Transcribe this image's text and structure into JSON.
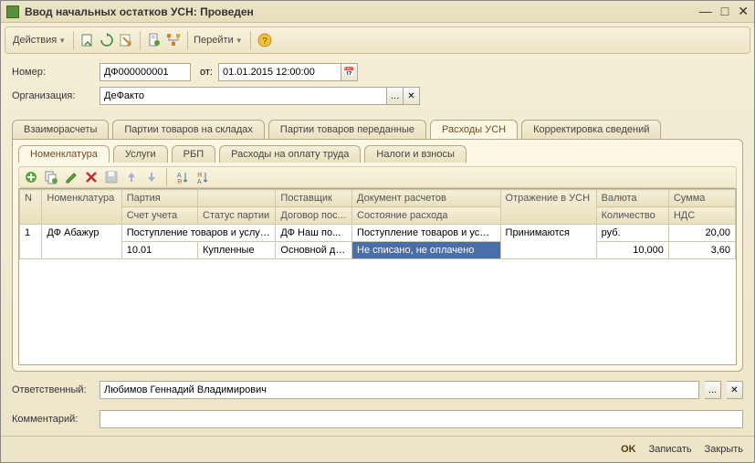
{
  "title": "Ввод начальных остатков УСН: Проведен",
  "toolbar": {
    "actions": "Действия",
    "goto": "Перейти"
  },
  "form": {
    "number_label": "Номер:",
    "number": "ДФ000000001",
    "date_label": "от:",
    "date": "01.01.2015 12:00:00",
    "org_label": "Организация:",
    "org": "ДеФакто",
    "resp_label": "Ответственный:",
    "resp": "Любимов Геннадий Владимирович",
    "comment_label": "Комментарий:",
    "comment": ""
  },
  "tabs1": [
    "Взаиморасчеты",
    "Партии товаров на складах",
    "Партии товаров переданные",
    "Расходы УСН",
    "Корректировка сведений"
  ],
  "tabs1_active": 3,
  "tabs2": [
    "Номенклатура",
    "Услуги",
    "РБП",
    "Расходы на оплату труда",
    "Налоги и взносы"
  ],
  "tabs2_active": 0,
  "grid": {
    "head_row1": [
      "N",
      "Номенклатура",
      "Партия",
      "Поставщик",
      "Документ расчетов",
      "Отражение в УСН",
      "Валюта",
      "Сумма"
    ],
    "head_row2": [
      "Счет учета",
      "Статус партии",
      "Договор пос...",
      "Состояние расхода",
      "Количество",
      "НДС"
    ],
    "rows": [
      {
        "n": "1",
        "nomen": "ДФ Абажур",
        "part": "Поступление товаров и услуг...",
        "supp": "ДФ Наш по...",
        "doc": "Поступление товаров и услу...",
        "refl": "Принимаются",
        "cur": "руб.",
        "sum": "20,00",
        "acct": "10.01",
        "status": "Купленные",
        "contract": "Основной до...",
        "state": "Не списано, не оплачено",
        "qty": "10,000",
        "vat": "3,60"
      }
    ]
  },
  "footer": {
    "ok": "OK",
    "write": "Записать",
    "close": "Закрыть"
  }
}
